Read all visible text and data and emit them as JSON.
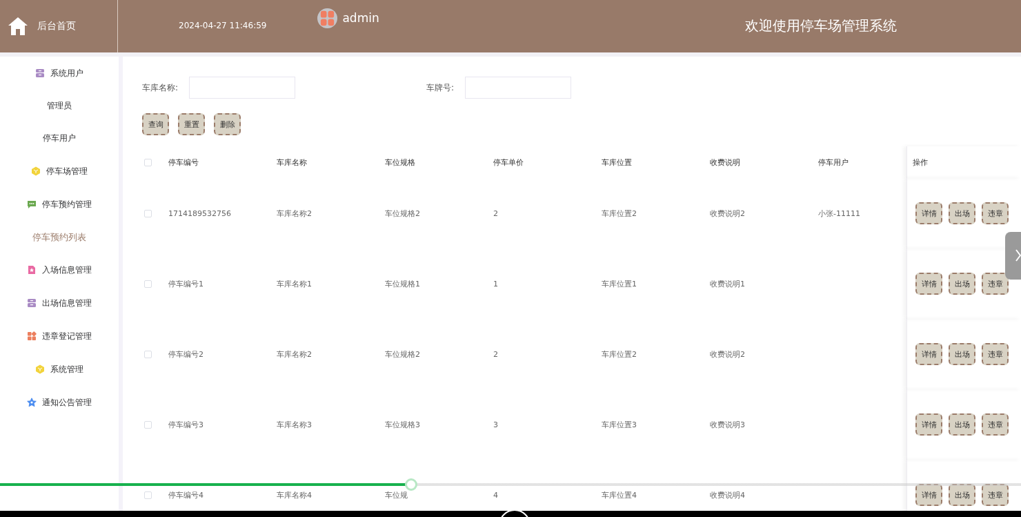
{
  "header": {
    "home_label": "后台首页",
    "datetime": "2024-04-27 11:46:59",
    "username": "admin",
    "title": "欢迎使用停车场管理系统"
  },
  "sidebar": {
    "items": [
      {
        "label": "系统用户",
        "kind": "archive",
        "children": [
          {
            "label": "管理员",
            "selected": false
          },
          {
            "label": "停车用户",
            "selected": false
          }
        ]
      },
      {
        "label": "停车场管理",
        "kind": "cube"
      },
      {
        "label": "停车预约管理",
        "kind": "chat",
        "children": [
          {
            "label": "停车预约列表",
            "selected": true
          }
        ]
      },
      {
        "label": "入场信息管理",
        "kind": "doc"
      },
      {
        "label": "出场信息管理",
        "kind": "archive"
      },
      {
        "label": "违章登记管理",
        "kind": "grid"
      },
      {
        "label": "系统管理",
        "kind": "cube"
      },
      {
        "label": "通知公告管理",
        "kind": "star"
      }
    ]
  },
  "search": {
    "fields": [
      {
        "label": "车库名称:"
      },
      {
        "label": "车牌号:"
      }
    ],
    "buttons": [
      "查询",
      "重置",
      "删除"
    ]
  },
  "table": {
    "columns": [
      "停车编号",
      "车库名称",
      "车位规格",
      "停车单价",
      "车库位置",
      "收费说明",
      "停车用户",
      "操作"
    ],
    "header_checked": false,
    "rows": [
      {
        "checked": false,
        "cells": [
          "1714189532756",
          "车库名称2",
          "车位规格2",
          "2",
          "车库位置2",
          "收费说明2",
          "小张-11111"
        ],
        "actions": [
          "详情",
          "出场",
          "违章"
        ]
      },
      {
        "checked": false,
        "cells": [
          "停车编号1",
          "车库名称1",
          "车位规格1",
          "1",
          "车库位置1",
          "收费说明1",
          ""
        ],
        "actions": [
          "详情",
          "出场",
          "违章"
        ]
      },
      {
        "checked": false,
        "cells": [
          "停车编号2",
          "车库名称2",
          "车位规格2",
          "2",
          "车库位置2",
          "收费说明2",
          ""
        ],
        "actions": [
          "详情",
          "出场",
          "违章"
        ]
      },
      {
        "checked": false,
        "cells": [
          "停车编号3",
          "车库名称3",
          "车位规格3",
          "3",
          "车库位置3",
          "收费说明3",
          ""
        ],
        "actions": [
          "详情",
          "出场",
          "违章"
        ]
      },
      {
        "checked": false,
        "cells": [
          "停车编号4",
          "车库名称4",
          "车位规",
          "4",
          "车库位置4",
          "收费说明4",
          ""
        ],
        "actions": [
          "详情",
          "出场",
          "违章"
        ]
      }
    ]
  },
  "video_player": {
    "progress": {
      "level": 0.403
    }
  }
}
